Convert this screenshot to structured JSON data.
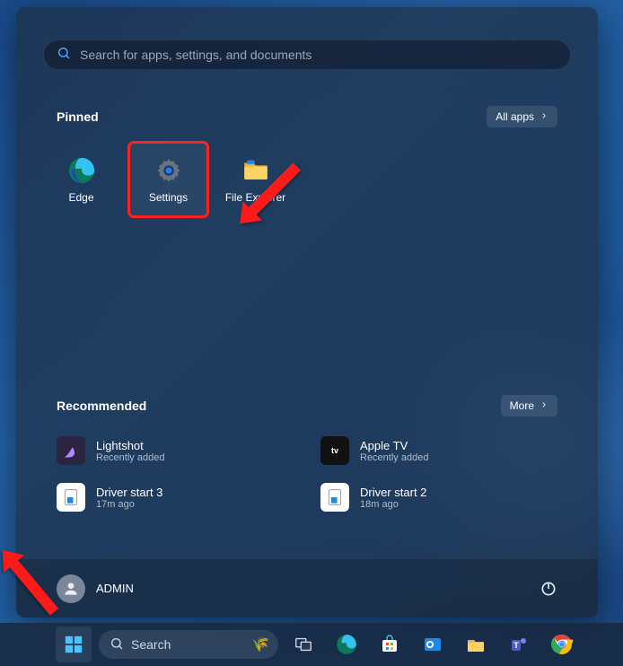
{
  "search": {
    "placeholder": "Search for apps, settings, and documents"
  },
  "pinned": {
    "title": "Pinned",
    "all_apps_label": "All apps",
    "apps": [
      {
        "label": "Edge"
      },
      {
        "label": "Settings"
      },
      {
        "label": "File Explorer"
      }
    ]
  },
  "recommended": {
    "title": "Recommended",
    "more_label": "More",
    "items": [
      {
        "title": "Lightshot",
        "sub": "Recently added"
      },
      {
        "title": "Apple TV",
        "sub": "Recently added"
      },
      {
        "title": "Driver start 3",
        "sub": "17m ago"
      },
      {
        "title": "Driver start 2",
        "sub": "18m ago"
      }
    ]
  },
  "user": {
    "name": "ADMIN"
  },
  "taskbar": {
    "search_label": "Search"
  }
}
